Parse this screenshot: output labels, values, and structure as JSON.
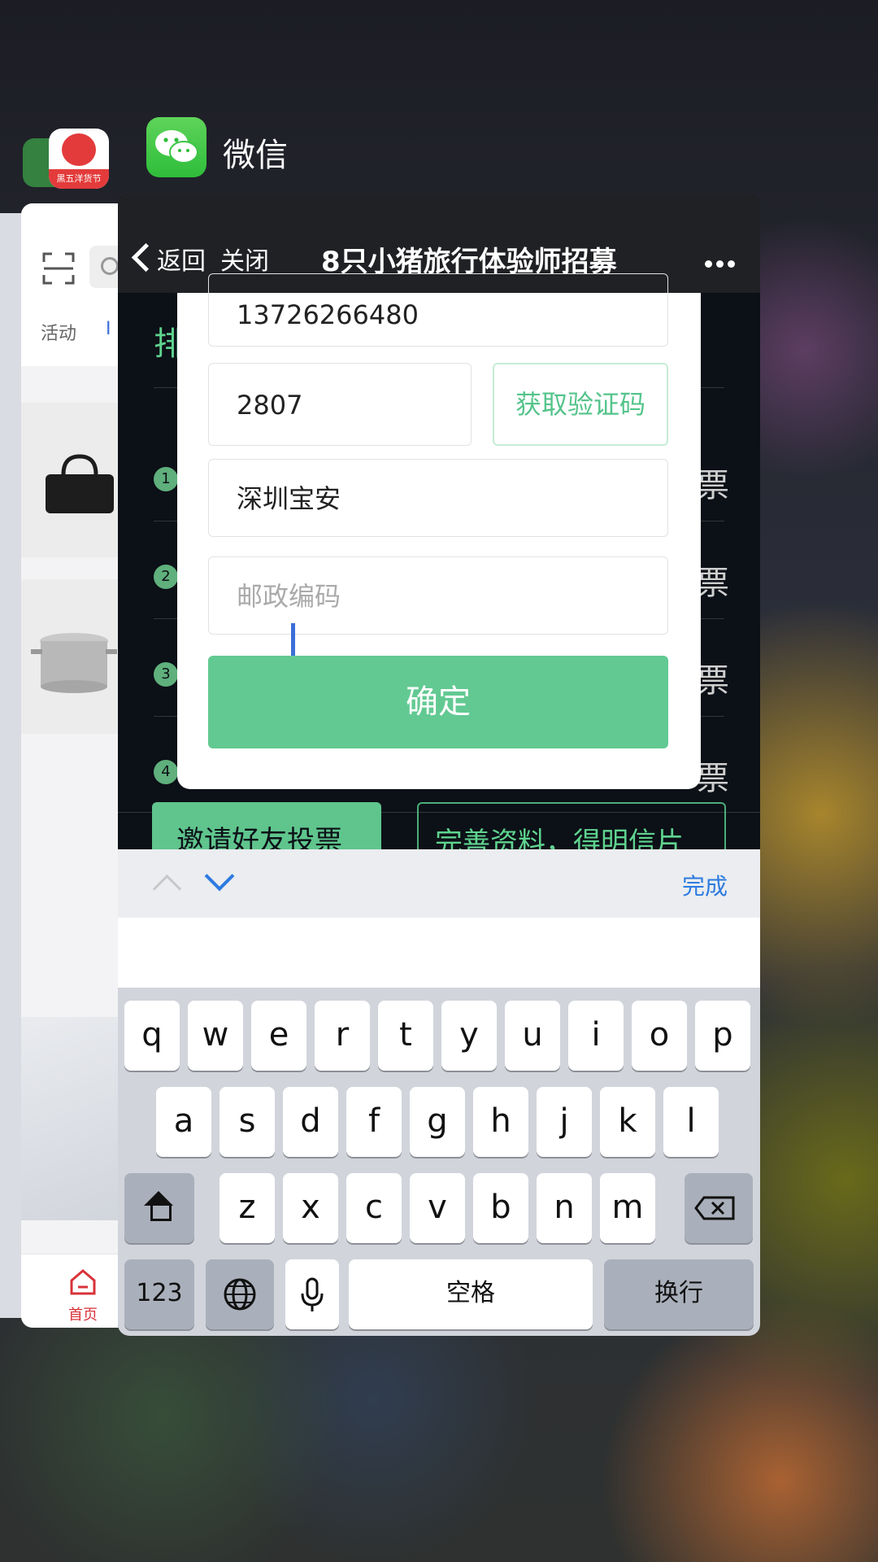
{
  "switcher": {
    "app_name": "微信"
  },
  "koala_app": {
    "badge_text": "黑五洋货节"
  },
  "background_app": {
    "tab_activity": "活动",
    "tab_second_partial": "I",
    "bottom_home_label": "首页"
  },
  "wechat_page": {
    "nav": {
      "back_label": "返回",
      "close_label": "关闭",
      "title": "8只小猪旅行体验师招募"
    },
    "page_heading_partial": "排",
    "rank_items": [
      {
        "number": "1",
        "suffix": "票"
      },
      {
        "number": "2",
        "suffix": "票"
      },
      {
        "number": "3",
        "suffix": "票"
      },
      {
        "number": "4",
        "suffix": "票"
      }
    ],
    "invite_button": "邀请好友投票",
    "profile_button": "完善资料，得明信片",
    "modal": {
      "phone_value": "13726266480",
      "code_value": "2807",
      "get_code_button": "获取验证码",
      "address_value": "深圳宝安",
      "zip_placeholder": "邮政编码",
      "confirm_button": "确定"
    }
  },
  "keyboard": {
    "done_label": "完成",
    "row1": [
      "q",
      "w",
      "e",
      "r",
      "t",
      "y",
      "u",
      "i",
      "o",
      "p"
    ],
    "row2": [
      "a",
      "s",
      "d",
      "f",
      "g",
      "h",
      "j",
      "k",
      "l"
    ],
    "row3": [
      "z",
      "x",
      "c",
      "v",
      "b",
      "n",
      "m"
    ],
    "num_key": "123",
    "space_key": "空格",
    "return_key": "换行"
  },
  "colors": {
    "wechat_green": "#2ebd3a",
    "confirm_green": "#62c992",
    "link_blue": "#2d7be0"
  }
}
